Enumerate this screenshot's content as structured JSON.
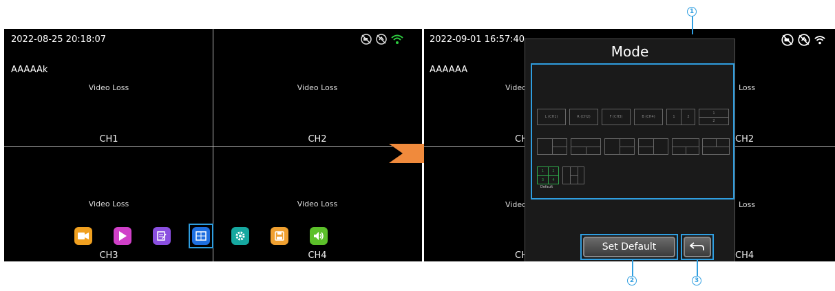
{
  "left_screen": {
    "timestamp": "2022-08-25 20:18:07",
    "device_name": "AAAAAk",
    "channels": [
      {
        "label": "CH1",
        "status": "Video Loss"
      },
      {
        "label": "CH2",
        "status": "Video Loss"
      },
      {
        "label": "CH3",
        "status": "Video Loss"
      },
      {
        "label": "CH4",
        "status": "Video Loss"
      }
    ],
    "status_icons": [
      "camera-off-icon",
      "signal-off-icon",
      "wifi-icon"
    ],
    "dock_icons": [
      {
        "name": "camera-icon",
        "color": "#f0a020"
      },
      {
        "name": "playback-icon",
        "color": "#d040c8"
      },
      {
        "name": "notes-icon",
        "color": "#8a4fe0"
      },
      {
        "name": "layout-icon",
        "color": "#1e6fe0",
        "selected": true
      },
      {
        "name": "settings-icon",
        "color": "#16a8a0"
      },
      {
        "name": "save-icon",
        "color": "#f0a030"
      },
      {
        "name": "volume-icon",
        "color": "#5cc02a"
      }
    ]
  },
  "right_screen": {
    "timestamp": "2022-09-01 16:57:40",
    "device_name": "AAAAAA",
    "bg_texts": {
      "video_left_top": "Video",
      "loss_right_top": "Loss",
      "ch_left_top": "CH",
      "ch_right_top": "CH2",
      "video_left_bottom": "Video",
      "loss_right_bottom": "Loss",
      "ch_left_bottom": "CH",
      "ch_right_bottom": "CH4"
    },
    "dialog": {
      "title": "Mode",
      "single_views": [
        "L (CH1)",
        "R (CH2)",
        "F (CH3)",
        "B (CH4)"
      ],
      "default_label": "Default",
      "set_default_label": "Set Default",
      "back_icon": "back-arrow-icon"
    }
  },
  "callouts": [
    "1",
    "2",
    "3"
  ],
  "colors": {
    "accent": "#2f9ee0",
    "arrow": "#f08a3c",
    "default_layout": "#2ea84a"
  }
}
